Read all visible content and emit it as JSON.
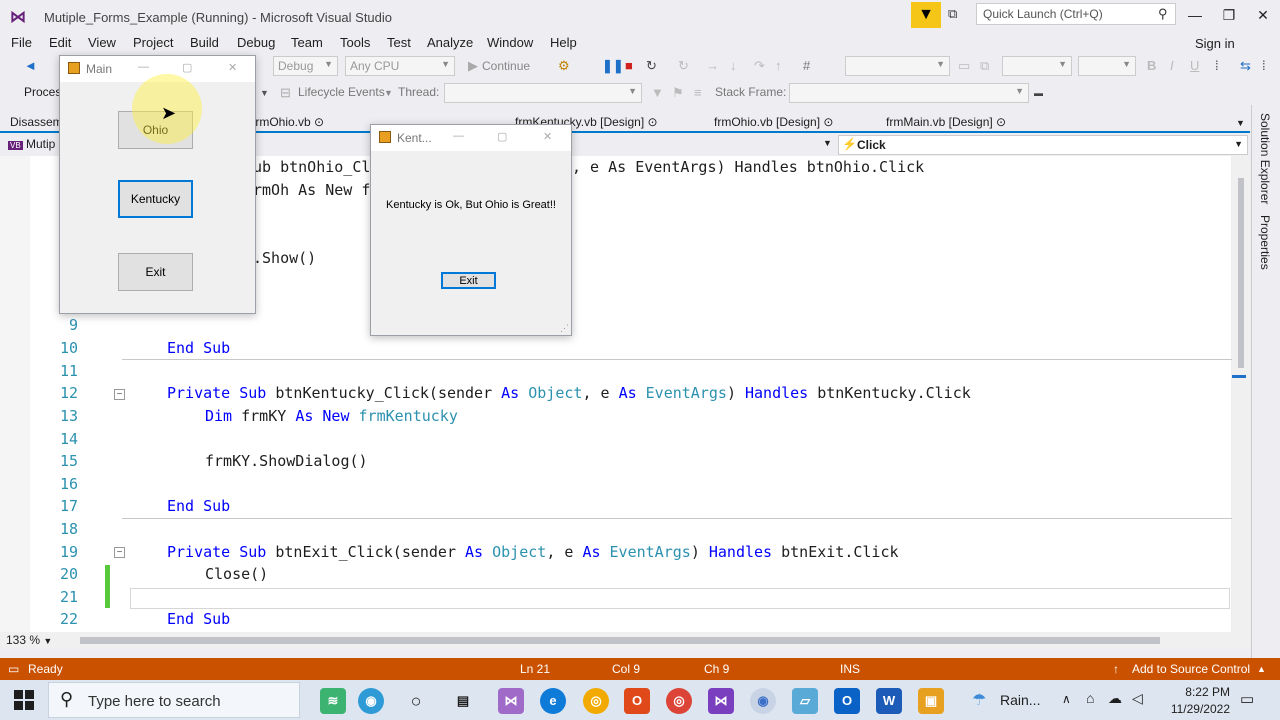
{
  "window": {
    "title": "Mutiple_Forms_Example (Running) - Microsoft Visual Studio",
    "quick_launch_placeholder": "Quick Launch (Ctrl+Q)",
    "sign_in": "Sign in"
  },
  "menu": [
    "File",
    "Edit",
    "View",
    "Project",
    "Build",
    "Debug",
    "Team",
    "Tools",
    "Test",
    "Analyze",
    "Window",
    "Help"
  ],
  "toolbar": {
    "config": "Debug",
    "platform": "Any CPU",
    "continue": "Continue",
    "process_label": "Process",
    "lifecycle_label": "Lifecycle Events",
    "thread_label": "Thread:",
    "stack_frame_label": "Stack Frame:"
  },
  "doc_tabs": [
    {
      "label": "Disassem"
    },
    {
      "label": "frmOhio.vb"
    },
    {
      "label": "frmKentucky.vb [Design]"
    },
    {
      "label": "frmOhio.vb [Design]"
    },
    {
      "label": "frmMain.vb [Design]"
    }
  ],
  "nav": {
    "left": "Mutip",
    "right": "Click"
  },
  "side_panels": [
    "Solution Explorer",
    "Properties"
  ],
  "code_lines": [
    {
      "n": "9"
    },
    {
      "n": "10"
    },
    {
      "n": "11"
    },
    {
      "n": "12"
    },
    {
      "n": "13"
    },
    {
      "n": "14"
    },
    {
      "n": "15"
    },
    {
      "n": "16"
    },
    {
      "n": "17"
    },
    {
      "n": "18"
    },
    {
      "n": "19"
    },
    {
      "n": "20"
    },
    {
      "n": "21"
    },
    {
      "n": "22"
    }
  ],
  "code_text": {
    "l_top1_a": "ub btnOhio_Cl",
    "l_top1_b": ", e As EventArgs) Handles btnOhio.Click",
    "l_top2": "rmOh As New f",
    "l_top3": ".Show()",
    "l10": "End Sub",
    "l12": "Private Sub btnKentucky_Click(sender As Object, e As EventArgs) Handles btnKentucky.Click",
    "l13": "Dim frmKY As New frmKentucky",
    "l15": "frmKY.ShowDialog()",
    "l17": "End Sub",
    "l19": "Private Sub btnExit_Click(sender As Object, e As EventArgs) Handles btnExit.Click",
    "l20": "Close()",
    "l22": "End Sub"
  },
  "zoom": "133 %",
  "status": {
    "ready": "Ready",
    "ln": "Ln 21",
    "col": "Col 9",
    "ch": "Ch 9",
    "ins": "INS",
    "source_control": "Add to Source Control"
  },
  "main_form": {
    "title": "Main",
    "buttons": [
      "Ohio",
      "Kentucky",
      "Exit"
    ]
  },
  "kentucky_form": {
    "title": "Kent...",
    "message": "Kentucky is Ok, But Ohio is Great!!",
    "exit": "Exit"
  },
  "taskbar": {
    "search_placeholder": "Type here to search",
    "weather": "Rain...",
    "time": "8:22 PM",
    "date": "11/29/2022"
  },
  "colors": {
    "status_bar": "#ca5100",
    "keyword": "#0000ff",
    "type": "#2b91af",
    "line_number": "#2b91af"
  }
}
